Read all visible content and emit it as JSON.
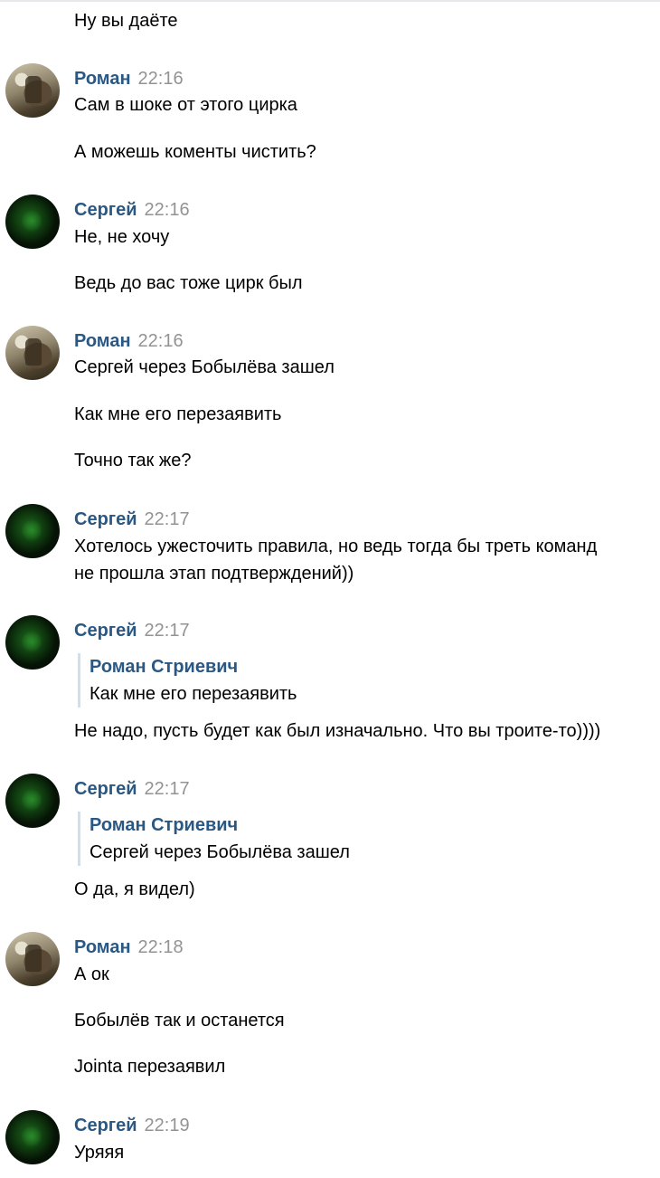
{
  "continuation": {
    "text": "Ну вы даёте"
  },
  "messages": [
    {
      "author": "Роман",
      "time": "22:16",
      "lines": [
        "Сам в шоке от этого цирка",
        "А можешь коменты чистить?"
      ]
    },
    {
      "author": "Сергей",
      "time": "22:16",
      "lines": [
        "Не, не хочу",
        "Ведь до вас тоже цирк был"
      ]
    },
    {
      "author": "Роман",
      "time": "22:16",
      "lines": [
        "Сергей через Бобылёва зашел",
        "Как мне его перезаявить",
        "Точно так же?"
      ]
    },
    {
      "author": "Сергей",
      "time": "22:17",
      "lines": [
        "Хотелось ужесточить правила, но ведь тогда бы треть команд",
        "не прошла этап подтверждений))"
      ]
    },
    {
      "author": "Сергей",
      "time": "22:17",
      "quote": {
        "author": "Роман Стриевич",
        "text": "Как мне его перезаявить"
      },
      "lines": [
        "Не надо, пусть будет как был изначально. Что вы троите-то))))"
      ]
    },
    {
      "author": "Сергей",
      "time": "22:17",
      "quote": {
        "author": "Роман Стриевич",
        "text": "Сергей через Бобылёва зашел"
      },
      "lines": [
        "О да, я видел)"
      ]
    },
    {
      "author": "Роман",
      "time": "22:18",
      "lines": [
        "А ок",
        "Бобылёв так и останется",
        "Jointa перезаявил"
      ]
    },
    {
      "author": "Сергей",
      "time": "22:19",
      "lines": [
        "Уряяя"
      ]
    }
  ]
}
